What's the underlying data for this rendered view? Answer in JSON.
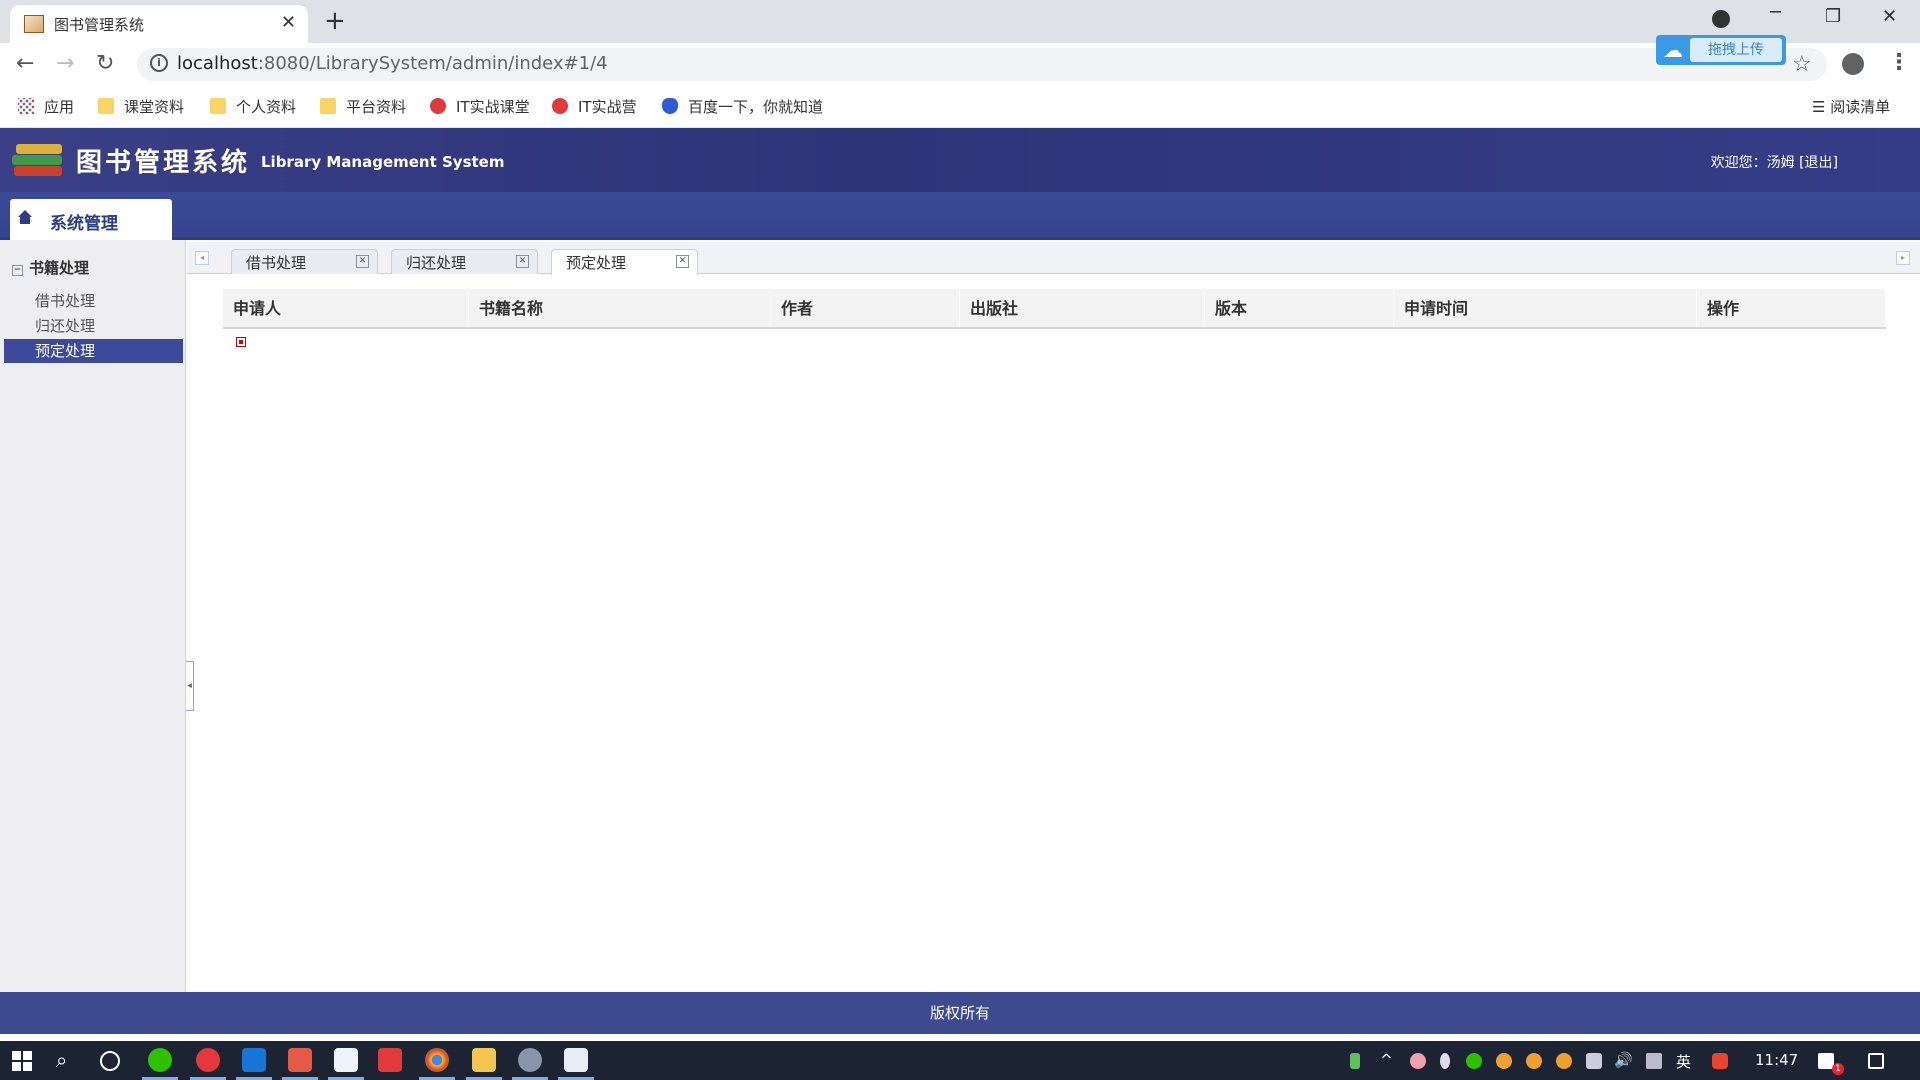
{
  "browser": {
    "tab_title": "图书管理系统",
    "tab_close": "✕",
    "new_tab": "+",
    "url_host": "localhost",
    "url_path": ":8080/LibrarySystem/admin/index#1/4",
    "upload_label": "拖拽上传",
    "reading_list": "阅读清单",
    "bookmarks": [
      {
        "label": "应用",
        "icon": "apps-icon"
      },
      {
        "label": "课堂资料",
        "icon": "folder-icon"
      },
      {
        "label": "个人资料",
        "icon": "folder-icon"
      },
      {
        "label": "平台资料",
        "icon": "folder-icon"
      },
      {
        "label": "IT实战课堂",
        "icon": "itshizhan-icon"
      },
      {
        "label": "IT实战营",
        "icon": "itshizhan-icon"
      },
      {
        "label": "百度一下，你就知道",
        "icon": "baidu-icon"
      }
    ]
  },
  "header": {
    "title": "图书管理系统",
    "subtitle": "Library Management System",
    "welcome": "欢迎您：汤姆",
    "logout": "[退出]"
  },
  "nav": {
    "module": "系统管理"
  },
  "sidebar": {
    "group": "书籍处理",
    "items": [
      {
        "label": "借书处理",
        "active": false
      },
      {
        "label": "归还处理",
        "active": false
      },
      {
        "label": "预定处理",
        "active": true
      }
    ]
  },
  "tabs": [
    {
      "label": "借书处理",
      "active": false
    },
    {
      "label": "归还处理",
      "active": false
    },
    {
      "label": "预定处理",
      "active": true
    }
  ],
  "table": {
    "columns": [
      "申请人",
      "书籍名称",
      "作者",
      "出版社",
      "版本",
      "申请时间",
      "操作"
    ],
    "rows": []
  },
  "footer": {
    "text": "版权所有"
  },
  "taskbar": {
    "time": "11:47",
    "ime": "英",
    "notification_count": "1"
  },
  "colors": {
    "header_bg": "#2e3478",
    "nav_strip": "#3a4a95",
    "active_item": "#3d4a9a",
    "footer_bg": "#3d4a8d",
    "upload_blue": "#3a9ae8"
  }
}
